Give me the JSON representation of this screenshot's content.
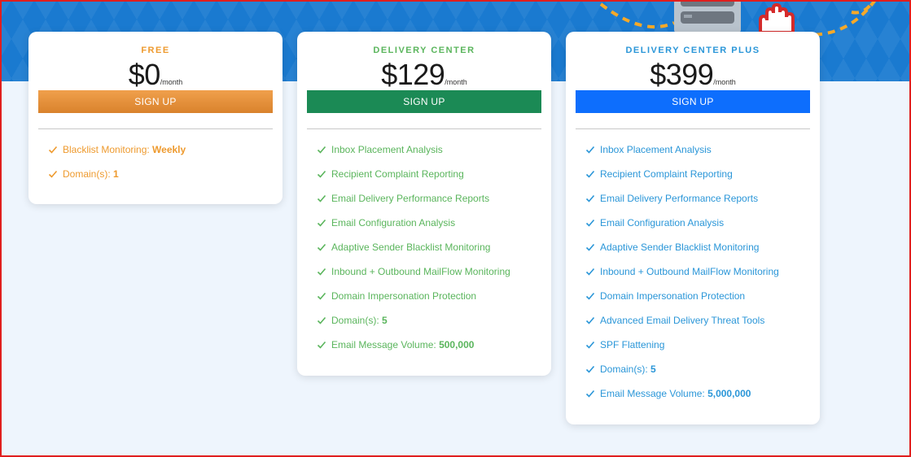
{
  "colors": {
    "hero_bg": "#1a7ad0",
    "page_bg": "#eef5fd",
    "free_accent": "#ee9a2e",
    "free_button": "#e8893a",
    "delivery_accent": "#5ab55c",
    "delivery_button": "#1b8a55",
    "plus_accent": "#2a96d8",
    "plus_button": "#0d6efd"
  },
  "plans": [
    {
      "name": "FREE",
      "price": "$0",
      "period": "/month",
      "button_label": "SIGN UP",
      "features": [
        {
          "label": "Blacklist Monitoring: ",
          "value": "Weekly"
        },
        {
          "label": "Domain(s): ",
          "value": "1"
        }
      ]
    },
    {
      "name": "DELIVERY CENTER",
      "price": "$129",
      "period": "/month",
      "button_label": "SIGN UP",
      "features": [
        {
          "label": "Inbox Placement Analysis",
          "value": ""
        },
        {
          "label": "Recipient Complaint Reporting",
          "value": ""
        },
        {
          "label": "Email Delivery Performance Reports",
          "value": ""
        },
        {
          "label": "Email Configuration Analysis",
          "value": ""
        },
        {
          "label": "Adaptive Sender Blacklist Monitoring",
          "value": ""
        },
        {
          "label": "Inbound + Outbound MailFlow Monitoring",
          "value": ""
        },
        {
          "label": "Domain Impersonation Protection",
          "value": ""
        },
        {
          "label": "Domain(s): ",
          "value": "5"
        },
        {
          "label": "Email Message Volume: ",
          "value": "500,000"
        }
      ]
    },
    {
      "name": "DELIVERY CENTER PLUS",
      "price": "$399",
      "period": "/month",
      "button_label": "SIGN UP",
      "features": [
        {
          "label": "Inbox Placement Analysis",
          "value": ""
        },
        {
          "label": "Recipient Complaint Reporting",
          "value": ""
        },
        {
          "label": "Email Delivery Performance Reports",
          "value": ""
        },
        {
          "label": "Email Configuration Analysis",
          "value": ""
        },
        {
          "label": "Adaptive Sender Blacklist Monitoring",
          "value": ""
        },
        {
          "label": "Inbound + Outbound MailFlow Monitoring",
          "value": ""
        },
        {
          "label": "Domain Impersonation Protection",
          "value": ""
        },
        {
          "label": "Advanced Email Delivery Threat Tools",
          "value": ""
        },
        {
          "label": "SPF Flattening",
          "value": ""
        },
        {
          "label": "Domain(s): ",
          "value": "5"
        },
        {
          "label": "Email Message Volume: ",
          "value": "5,000,000"
        }
      ]
    }
  ]
}
